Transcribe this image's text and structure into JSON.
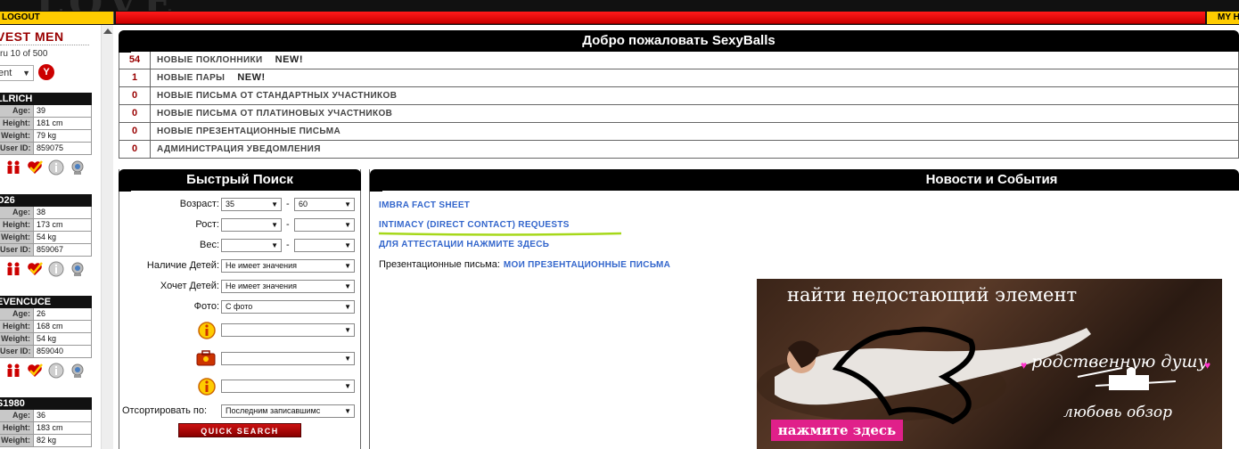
{
  "header": {
    "logout_label": "R LOGOUT",
    "my_label": "MY H"
  },
  "left": {
    "title": "VEST MEN",
    "count": "ru 10 of 500",
    "select_value": "ent",
    "go_label": "Y",
    "cards": [
      {
        "name": "LLRICH",
        "age": "39",
        "height": "181 cm",
        "weight": "79 kg",
        "user_id": "859075"
      },
      {
        "name": "O26",
        "age": "38",
        "height": "173 cm",
        "weight": "54 kg",
        "user_id": "859067"
      },
      {
        "name": "EVENCUCE",
        "age": "26",
        "height": "168 cm",
        "weight": "54 kg",
        "user_id": "859040"
      },
      {
        "name": "S1980",
        "age": "36",
        "height": "183 cm",
        "weight": "82 kg",
        "user_id": ""
      }
    ],
    "labels": {
      "age": "Age:",
      "height": "Height:",
      "weight": "Weight:",
      "user_id": "User ID:"
    }
  },
  "welcome": {
    "title": "Добро пожаловать SexyBalls",
    "rows": [
      {
        "count": "54",
        "label": "НОВЫЕ ПОКЛОННИКИ",
        "badge": "NEW!"
      },
      {
        "count": "1",
        "label": "НОВЫЕ ПАРЫ",
        "badge": "NEW!"
      },
      {
        "count": "0",
        "label": "НОВЫЕ ПИСЬМА ОТ СТАНДАРТНЫХ УЧАСТНИКОВ",
        "badge": ""
      },
      {
        "count": "0",
        "label": "НОВЫЕ ПИСЬМА ОТ ПЛАТИНОВЫХ УЧАСТНИКОВ",
        "badge": ""
      },
      {
        "count": "0",
        "label": "НОВЫЕ ПРЕЗЕНТАЦИОННЫЕ ПИСЬМА",
        "badge": ""
      },
      {
        "count": "0",
        "label": "АДМИНИСТРАЦИЯ УВЕДОМЛЕНИЯ",
        "badge": ""
      }
    ]
  },
  "search": {
    "title": "Быстрый Поиск",
    "age_label": "Возраст:",
    "age_from": "35",
    "age_to": "60",
    "height_label": "Рост:",
    "height_from": "",
    "height_to": "",
    "weight_label": "Вес:",
    "weight_from": "",
    "weight_to": "",
    "children_label": "Наличие Детей:",
    "children_value": "Не имеет значения",
    "want_children_label": "Хочет Детей:",
    "want_children_value": "Не имеет значения",
    "photo_label": "Фото:",
    "photo_value": "С фото",
    "extra1_value": "",
    "extra2_value": "",
    "extra3_value": "",
    "sort_label": "Отсортировать по:",
    "sort_value": "Последним записавшимс",
    "button_label": "QUICK SEARCH"
  },
  "news": {
    "title": "Новости и События",
    "links": [
      "IMBRA FACT SHEET",
      "INTIMACY (DIRECT CONTACT) REQUESTS",
      "ДЛЯ АТТЕСТАЦИИ НАЖМИТЕ ЗДЕСЬ"
    ],
    "pres_label": "Презентационные письма:",
    "pres_link": "МОИ ПРЕЗЕНТАЦИОННЫЕ ПИСЬМА",
    "underline_color": "#a6d81a"
  },
  "banner": {
    "headline": "найти недостающий элемент",
    "subline": "родственную душу",
    "tagline": "любовь обзор",
    "cta": "нажмите здесь",
    "cta_color": "#e0208a"
  }
}
